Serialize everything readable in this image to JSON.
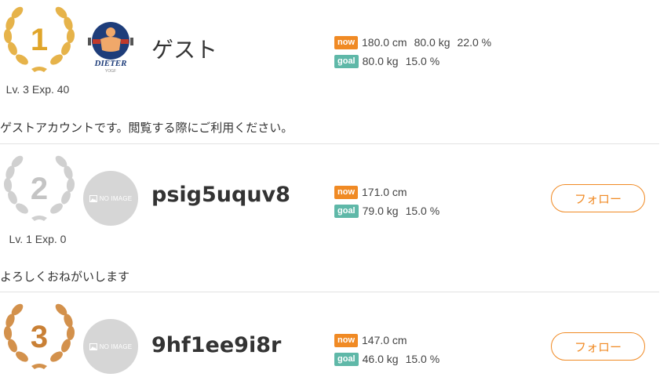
{
  "colors": {
    "accent": "#f08a24",
    "goal_badge": "#5fb8a8",
    "gold": "#e0a52a",
    "silver": "#c4c4c4",
    "bronze": "#c98035",
    "divider": "#e2e2e2"
  },
  "ranking": [
    {
      "rank": "1",
      "medal": "gold",
      "level_text": "Lv. 3 Exp. 40",
      "avatar_icon": "dieter-logo-icon",
      "avatar_caption": "DIETER",
      "avatar_sub": "YOGF",
      "username": "ゲスト",
      "now_badge": "now",
      "now_values": [
        "180.0 cm",
        "80.0 kg",
        "22.0 %"
      ],
      "goal_badge": "goal",
      "goal_values": [
        "80.0 kg",
        "15.0 %"
      ],
      "intro": "ゲストアカウントです。閲覧する際にご利用ください。"
    },
    {
      "rank": "2",
      "medal": "silver",
      "level_text": "Lv. 1 Exp. 0",
      "avatar_icon": "no-image-icon",
      "avatar_caption": "NO IMAGE",
      "username": "psig5uquv8",
      "now_badge": "now",
      "now_values": [
        "171.0 cm"
      ],
      "goal_badge": "goal",
      "goal_values": [
        "79.0 kg",
        "15.0 %"
      ],
      "follow_label": "フォロー",
      "intro": "よろしくおねがいします"
    },
    {
      "rank": "3",
      "medal": "bronze",
      "avatar_icon": "no-image-icon",
      "avatar_caption": "NO IMAGE",
      "username": "9hf1ee9i8r",
      "now_badge": "now",
      "now_values": [
        "147.0 cm"
      ],
      "goal_badge": "goal",
      "goal_values": [
        "46.0 kg",
        "15.0 %"
      ],
      "follow_label": "フォロー"
    }
  ]
}
